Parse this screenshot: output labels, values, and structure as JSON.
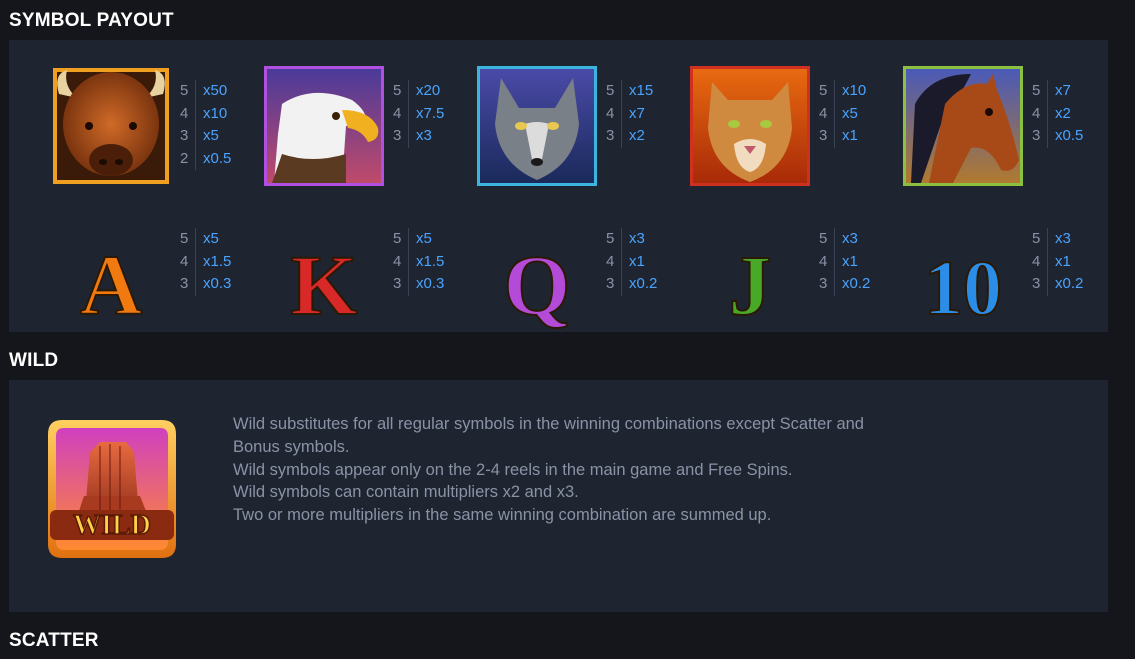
{
  "sections": {
    "payout_title": "SYMBOL PAYOUT",
    "wild_title": "WILD",
    "scatter_title": "SCATTER"
  },
  "symbols_high": [
    {
      "icon": "bison-icon",
      "border": "#f0a020",
      "rows": [
        {
          "count": "5",
          "mult": "x50"
        },
        {
          "count": "4",
          "mult": "x10"
        },
        {
          "count": "3",
          "mult": "x5"
        },
        {
          "count": "2",
          "mult": "x0.5"
        }
      ]
    },
    {
      "icon": "eagle-icon",
      "border": "#b150e0",
      "rows": [
        {
          "count": "5",
          "mult": "x20"
        },
        {
          "count": "4",
          "mult": "x7.5"
        },
        {
          "count": "3",
          "mult": "x3"
        }
      ]
    },
    {
      "icon": "wolf-icon",
      "border": "#3cb4e0",
      "rows": [
        {
          "count": "5",
          "mult": "x15"
        },
        {
          "count": "4",
          "mult": "x7"
        },
        {
          "count": "3",
          "mult": "x2"
        }
      ]
    },
    {
      "icon": "cougar-icon",
      "border": "#d03020",
      "rows": [
        {
          "count": "5",
          "mult": "x10"
        },
        {
          "count": "4",
          "mult": "x5"
        },
        {
          "count": "3",
          "mult": "x1"
        }
      ]
    },
    {
      "icon": "horse-icon",
      "border": "#8cc040",
      "rows": [
        {
          "count": "5",
          "mult": "x7"
        },
        {
          "count": "4",
          "mult": "x2"
        },
        {
          "count": "3",
          "mult": "x0.5"
        }
      ]
    }
  ],
  "symbols_low": [
    {
      "icon": "letter-a-icon",
      "glyph": "A",
      "color": "#f07a10",
      "rows": [
        {
          "count": "5",
          "mult": "x5"
        },
        {
          "count": "4",
          "mult": "x1.5"
        },
        {
          "count": "3",
          "mult": "x0.3"
        }
      ]
    },
    {
      "icon": "letter-k-icon",
      "glyph": "K",
      "color": "#d82828",
      "rows": [
        {
          "count": "5",
          "mult": "x5"
        },
        {
          "count": "4",
          "mult": "x1.5"
        },
        {
          "count": "3",
          "mult": "x0.3"
        }
      ]
    },
    {
      "icon": "letter-q-icon",
      "glyph": "Q",
      "color": "#b44ad8",
      "rows": [
        {
          "count": "5",
          "mult": "x3"
        },
        {
          "count": "4",
          "mult": "x1"
        },
        {
          "count": "3",
          "mult": "x0.2"
        }
      ]
    },
    {
      "icon": "letter-j-icon",
      "glyph": "J",
      "color": "#4aa828",
      "rows": [
        {
          "count": "5",
          "mult": "x3"
        },
        {
          "count": "4",
          "mult": "x1"
        },
        {
          "count": "3",
          "mult": "x0.2"
        }
      ]
    },
    {
      "icon": "number-10-icon",
      "glyph": "10",
      "color": "#2a8ee8",
      "rows": [
        {
          "count": "5",
          "mult": "x3"
        },
        {
          "count": "4",
          "mult": "x1"
        },
        {
          "count": "3",
          "mult": "x0.2"
        }
      ]
    }
  ],
  "wild": {
    "badge_text": "WILD",
    "lines": [
      "Wild substitutes for all regular symbols in the winning combinations except Scatter and",
      "Bonus symbols.",
      "Wild symbols appear only on the 2-4 reels in the main game and Free Spins.",
      "Wild symbols can contain multipliers x2 and x3.",
      "Two or more multipliers in the same winning combination are summed up."
    ]
  }
}
